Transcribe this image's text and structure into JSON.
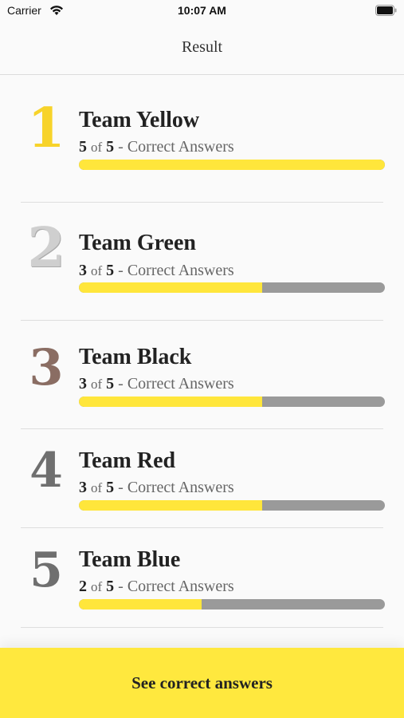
{
  "status_bar": {
    "carrier": "Carrier",
    "time": "10:07 AM"
  },
  "nav": {
    "title": "Result"
  },
  "results": [
    {
      "rank": "1",
      "team": "Team Yellow",
      "correct": "5",
      "of": "of",
      "total": "5",
      "suffix": "- Correct Answers",
      "fraction": 1.0,
      "rank_color": "#f7d32a"
    },
    {
      "rank": "2",
      "team": "Team Green",
      "correct": "3",
      "of": "of",
      "total": "5",
      "suffix": "- Correct Answers",
      "fraction": 0.6,
      "rank_color": "#c9c9c9"
    },
    {
      "rank": "3",
      "team": "Team Black",
      "correct": "3",
      "of": "of",
      "total": "5",
      "suffix": "- Correct Answers",
      "fraction": 0.6,
      "rank_color": "#8a6d63"
    },
    {
      "rank": "4",
      "team": "Team Red",
      "correct": "3",
      "of": "of",
      "total": "5",
      "suffix": "- Correct Answers",
      "fraction": 0.6,
      "rank_color": "#6f6f6f"
    },
    {
      "rank": "5",
      "team": "Team Blue",
      "correct": "2",
      "of": "of",
      "total": "5",
      "suffix": "- Correct Answers",
      "fraction": 0.4,
      "rank_color": "#6f6f6f"
    }
  ],
  "cta": {
    "label": "See correct answers"
  },
  "colors": {
    "accent": "#ffe63b",
    "track": "#9a9a9a"
  }
}
